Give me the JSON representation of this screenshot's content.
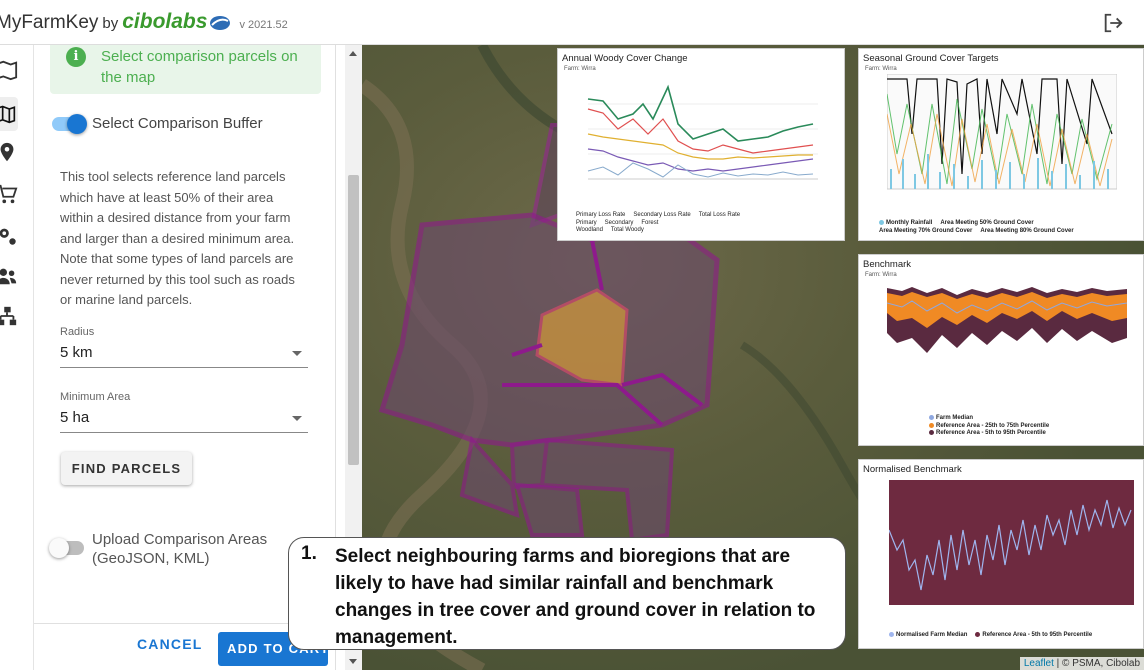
{
  "header": {
    "app_name": "MyFarmKey",
    "by": "by",
    "partner": "cibolabs",
    "version": "v 2021.52",
    "logout_icon": "logout-icon"
  },
  "rail": {
    "icons": [
      "map-icon",
      "compare-parcels-icon",
      "location-pin-icon",
      "cart-icon",
      "settings-icon",
      "group-icon",
      "sitemap-icon"
    ]
  },
  "panel": {
    "info_text": "Select comparison parcels on the map",
    "buffer_toggle_label": "Select Comparison Buffer",
    "buffer_toggle_on": true,
    "description": "This tool selects reference land parcels which have at least 50% of their area within a desired distance from your farm and larger than a desired minimum area. Note that some types of land parcels are never returned by this tool such as roads or marine land parcels.",
    "radius": {
      "label": "Radius",
      "value": "5 km"
    },
    "min_area": {
      "label": "Minimum Area",
      "value": "5 ha"
    },
    "find_button": "FIND PARCELS",
    "upload_toggle_label": "Upload Comparison Areas (GeoJSON, KML)",
    "upload_toggle_on": false,
    "cancel_button": "CANCEL",
    "add_button": "ADD TO CART"
  },
  "charts": {
    "woody": {
      "title": "Annual Woody Cover Change",
      "subtitle": "Farm: Wirra",
      "legend": [
        "Primary Loss Rate",
        "Secondary Loss Rate",
        "Total Loss Rate",
        "Primary",
        "Secondary",
        "Forest",
        "Woodland",
        "Total Woody"
      ]
    },
    "seasonal": {
      "title": "Seasonal Ground Cover Targets",
      "subtitle": "Farm: Wirra",
      "legend": [
        "Monthly Rainfall",
        "Area Meeting 50% Ground Cover",
        "Area Meeting 70% Ground Cover",
        "Area Meeting 80% Ground Cover"
      ]
    },
    "benchmark": {
      "title": "Benchmark",
      "subtitle": "Farm: Wirra",
      "legend": [
        "Farm Median",
        "Reference Area - 25th to 75th Percentile",
        "Reference Area - 5th to 95th Percentile"
      ]
    },
    "normalised": {
      "title": "Normalised Benchmark",
      "legend": [
        "Normalised Farm Median",
        "Reference Area - 5th to 95th Percentile"
      ]
    }
  },
  "callout": {
    "number": "1.",
    "text": "Select neighbouring farms and bioregions that are likely to have had similar rainfall and benchmark changes in tree cover and ground cover in relation to management."
  },
  "attribution": {
    "leaflet": "Leaflet",
    "rest": " | © PSMA, Cibolab"
  },
  "colors": {
    "accent": "#1976d2",
    "info_green": "#4caf50",
    "parcel_purple": "#8e1a8c",
    "farm_orange": "#e0a43a"
  }
}
